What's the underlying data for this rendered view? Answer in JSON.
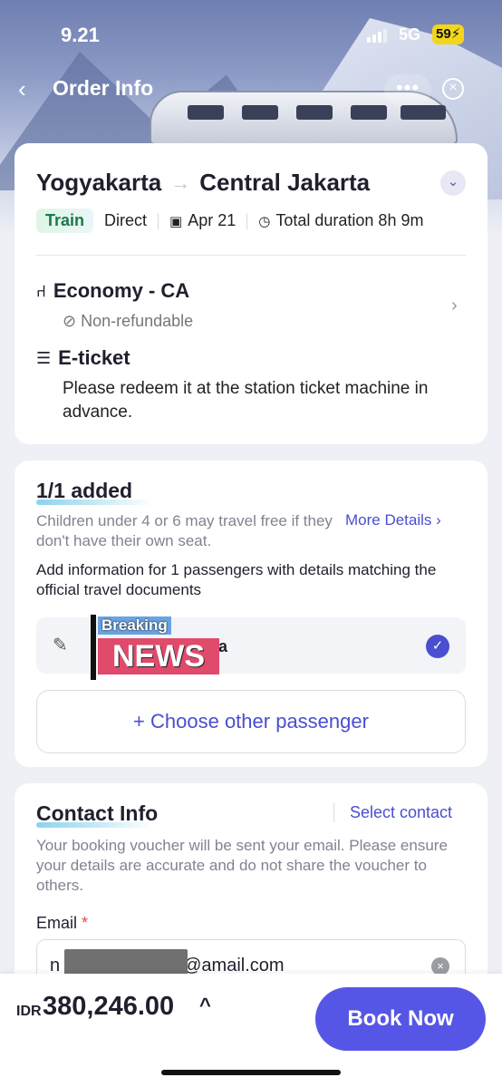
{
  "status_bar": {
    "time": "9.21",
    "network": "5G",
    "battery": "59"
  },
  "nav": {
    "title": "Order Info",
    "more_icon": "•••",
    "close_icon": "⊗"
  },
  "trip": {
    "from": "Yogyakarta",
    "to": "Central Jakarta",
    "mode_tag": "Train",
    "route_type": "Direct",
    "date": "Apr 21",
    "duration": "Total duration 8h 9m",
    "seat_class": "Economy - CA",
    "refund_policy": "Non-refundable",
    "ticket_type": "E-ticket",
    "ticket_note": "Please redeem it at the station ticket machine in advance."
  },
  "passengers": {
    "heading": "1/1 added",
    "child_note": "Children under 4 or 6 may travel free if they don't have their own seat.",
    "more_details_link": "More Details",
    "add_info": "Add information for 1 passengers with details matching the official travel documents",
    "overlay_top": "Breaking",
    "overlay_bottom": "NEWS",
    "name_suffix": "ua",
    "choose_other": "+ Choose other passenger"
  },
  "contact": {
    "heading": "Contact Info",
    "select_contact": "Select contact",
    "description": "Your booking voucher will be sent your email. Please ensure your details are accurate and do not share the voucher to others.",
    "email_label": "Email",
    "required_mark": "*",
    "email_prefix": "n",
    "email_suffix": "@amail.com"
  },
  "footer": {
    "currency": "IDR",
    "price": "380,246.00",
    "book_label": "Book Now"
  },
  "colors": {
    "accent": "#4a4ed1",
    "book_button": "#5656e6",
    "tag_green": "#1a7a45",
    "battery": "#f3d51a"
  }
}
